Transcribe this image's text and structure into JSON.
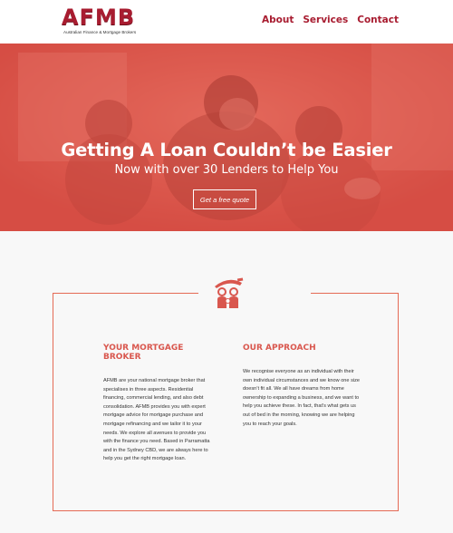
{
  "brand": {
    "name": "AFMB",
    "tagline": "Australian Finance & Mortgage Brokers",
    "accent": "#a81c30",
    "coral": "#d9574e"
  },
  "nav": {
    "items": [
      "About",
      "Services",
      "Contact"
    ]
  },
  "hero": {
    "title": "Getting A Loan Couldn’t be Easier",
    "subtitle": "Now with over 30 Lenders to Help You",
    "cta_label": "Get a free quote"
  },
  "icons": {
    "emblem": "family-umbrella-icon"
  },
  "sections": {
    "broker": {
      "heading": "YOUR MORTGAGE BROKER",
      "body": "AFMB are your national mortgage broker that specialises in three aspects. Residential financing, commercial lending, and also debt consolidation. AFMB provides you with expert mortgage advice for mortgage purchase and mortgage refinancing and we tailor it to your needs. We explore all avenues to provide you with the finance you need. Based in Parramatta and in the Sydney CBD, we are always here to help you get the right mortgage loan."
    },
    "approach": {
      "heading": "OUR APPROACH",
      "body": "We recognise everyone as an individual with their own individual circumstances and we know one size doesn’t fit all. We all have dreams from home ownership to expanding a business, and we want to help you achieve these.  In fact, that’s what gets us out of bed in the morning, knowing we are helping you to reach your goals."
    }
  }
}
